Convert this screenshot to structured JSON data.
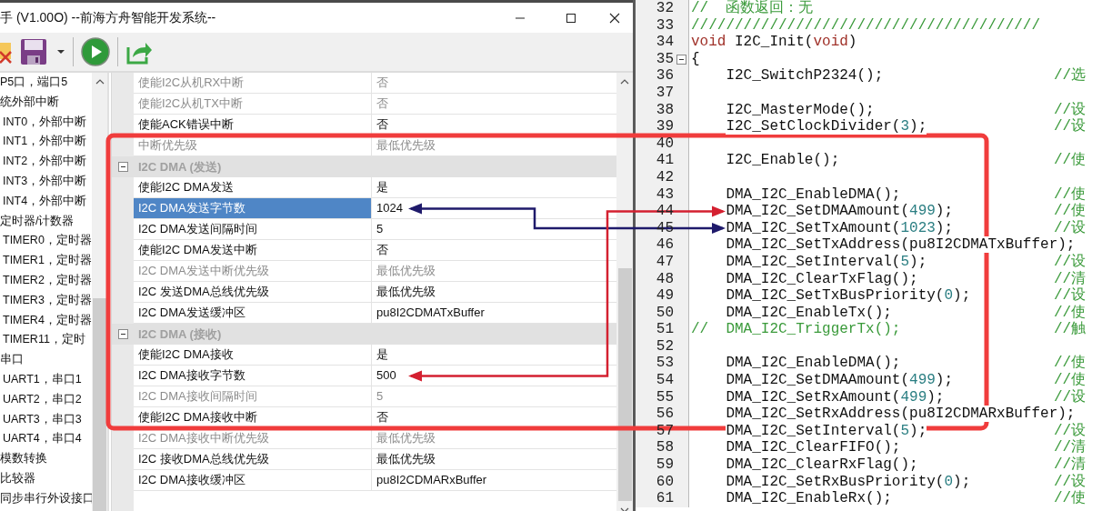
{
  "window": {
    "title": "手 (V1.00O) --前海方舟智能开发系统--"
  },
  "tree": {
    "items": [
      {
        "label": "P5口，端口5"
      },
      {
        "label": "统外部中断",
        "children": [
          {
            "label": "INT0，外部中断"
          },
          {
            "label": "INT1，外部中断"
          },
          {
            "label": "INT2，外部中断"
          },
          {
            "label": "INT3，外部中断"
          },
          {
            "label": "INT4，外部中断"
          }
        ]
      },
      {
        "label": "定时器/计数器",
        "children": [
          {
            "label": "TIMER0，定时器"
          },
          {
            "label": "TIMER1，定时器"
          },
          {
            "label": "TIMER2，定时器"
          },
          {
            "label": "TIMER3，定时器"
          },
          {
            "label": "TIMER4，定时器"
          },
          {
            "label": "TIMER11，定时"
          }
        ]
      },
      {
        "label": "串口",
        "children": [
          {
            "label": "UART1，串口1"
          },
          {
            "label": "UART2，串口2"
          },
          {
            "label": "UART3，串口3"
          },
          {
            "label": "UART4，串口4"
          }
        ]
      },
      {
        "label": "模数转换"
      },
      {
        "label": "比较器"
      },
      {
        "label": "同步串行外设接口"
      }
    ]
  },
  "property_grid": {
    "rows": [
      {
        "kind": "property",
        "name": "使能I2C从机RX中断",
        "value": "否",
        "disabled": true,
        "selected": false
      },
      {
        "kind": "property",
        "name": "使能I2C从机TX中断",
        "value": "否",
        "disabled": true,
        "selected": false
      },
      {
        "kind": "property",
        "name": "使能ACK错误中断",
        "value": "否",
        "disabled": false,
        "selected": false
      },
      {
        "kind": "property",
        "name": "中断优先级",
        "value": "最低优先级",
        "disabled": true,
        "selected": false
      },
      {
        "kind": "category",
        "label": "I2C DMA (发送)",
        "expanded": true
      },
      {
        "kind": "property",
        "name": "使能I2C DMA发送",
        "value": "是",
        "disabled": false,
        "selected": false
      },
      {
        "kind": "property",
        "name": "I2C DMA发送字节数",
        "value": "1024",
        "disabled": false,
        "selected": true
      },
      {
        "kind": "property",
        "name": "I2C DMA发送间隔时间",
        "value": "5",
        "disabled": false,
        "selected": false
      },
      {
        "kind": "property",
        "name": "使能I2C DMA发送中断",
        "value": "否",
        "disabled": false,
        "selected": false
      },
      {
        "kind": "property",
        "name": "I2C DMA发送中断优先级",
        "value": "最低优先级",
        "disabled": true,
        "selected": false
      },
      {
        "kind": "property",
        "name": "I2C 发送DMA总线优先级",
        "value": "最低优先级",
        "disabled": false,
        "selected": false
      },
      {
        "kind": "property",
        "name": "I2C DMA发送缓冲区",
        "value": "pu8I2CDMATxBuffer",
        "disabled": false,
        "selected": false
      },
      {
        "kind": "category",
        "label": "I2C DMA (接收)",
        "expanded": true
      },
      {
        "kind": "property",
        "name": "使能I2C DMA接收",
        "value": "是",
        "disabled": false,
        "selected": false
      },
      {
        "kind": "property",
        "name": "I2C DMA接收字节数",
        "value": "500",
        "disabled": false,
        "selected": false
      },
      {
        "kind": "property",
        "name": "I2C DMA接收间隔时间",
        "value": "5",
        "disabled": true,
        "selected": false
      },
      {
        "kind": "property",
        "name": "使能I2C DMA接收中断",
        "value": "否",
        "disabled": false,
        "selected": false
      },
      {
        "kind": "property",
        "name": "I2C DMA接收中断优先级",
        "value": "最低优先级",
        "disabled": true,
        "selected": false
      },
      {
        "kind": "property",
        "name": "I2C 接收DMA总线优先级",
        "value": "最低优先级",
        "disabled": false,
        "selected": false
      },
      {
        "kind": "property",
        "name": "I2C DMA接收缓冲区",
        "value": "pu8I2CDMARxBuffer",
        "disabled": false,
        "selected": false
      }
    ]
  },
  "editor": {
    "lines": [
      {
        "number": "32",
        "fold": false,
        "parts": [
          {
            "kind": "comment",
            "text": "//  函数返回：无"
          }
        ]
      },
      {
        "number": "33",
        "fold": false,
        "parts": [
          {
            "kind": "comment",
            "text": "////////////////////////////////////////"
          }
        ]
      },
      {
        "number": "34",
        "fold": false,
        "parts": [
          {
            "kind": "keyword",
            "text": "void"
          },
          {
            "kind": "plain",
            "text": " I2C_Init("
          },
          {
            "kind": "keyword",
            "text": "void"
          },
          {
            "kind": "plain",
            "text": ")"
          }
        ]
      },
      {
        "number": "35",
        "fold": true,
        "parts": [
          {
            "kind": "plain",
            "text": "{"
          }
        ]
      },
      {
        "number": "36",
        "fold": false,
        "parts": [
          {
            "kind": "plain",
            "text": "    I2C_SwitchP2324();"
          }
        ],
        "comment": "//选"
      },
      {
        "number": "37",
        "fold": false
      },
      {
        "number": "38",
        "fold": false,
        "parts": [
          {
            "kind": "plain",
            "text": "    I2C_MasterMode();"
          }
        ],
        "comment": "//设"
      },
      {
        "number": "39",
        "fold": false,
        "parts": [
          {
            "kind": "plain",
            "text": "    I2C_SetClockDivider("
          },
          {
            "kind": "number",
            "text": "3"
          },
          {
            "kind": "plain",
            "text": ");"
          }
        ],
        "comment": "//设"
      },
      {
        "number": "40",
        "fold": false
      },
      {
        "number": "41",
        "fold": false,
        "parts": [
          {
            "kind": "plain",
            "text": "    I2C_Enable();"
          }
        ],
        "comment": "//使"
      },
      {
        "number": "42",
        "fold": false
      },
      {
        "number": "43",
        "fold": false,
        "parts": [
          {
            "kind": "plain",
            "text": "    DMA_I2C_EnableDMA();"
          }
        ],
        "comment": "//使"
      },
      {
        "number": "44",
        "fold": false,
        "parts": [
          {
            "kind": "plain",
            "text": "    DMA_I2C_SetDMAAmount("
          },
          {
            "kind": "number",
            "text": "499"
          },
          {
            "kind": "plain",
            "text": ");"
          }
        ],
        "comment": "//使"
      },
      {
        "number": "45",
        "fold": false,
        "parts": [
          {
            "kind": "plain",
            "text": "    DMA_I2C_SetTxAmount("
          },
          {
            "kind": "number",
            "text": "1023"
          },
          {
            "kind": "plain",
            "text": ");"
          }
        ],
        "comment": "//设"
      },
      {
        "number": "46",
        "fold": false,
        "parts": [
          {
            "kind": "plain",
            "text": "    DMA_I2C_SetTxAddress(pu8I2CDMATxBuffer);"
          }
        ]
      },
      {
        "number": "47",
        "fold": false,
        "parts": [
          {
            "kind": "plain",
            "text": "    DMA_I2C_SetInterval("
          },
          {
            "kind": "number",
            "text": "5"
          },
          {
            "kind": "plain",
            "text": ");"
          }
        ],
        "comment": "//设"
      },
      {
        "number": "48",
        "fold": false,
        "parts": [
          {
            "kind": "plain",
            "text": "    DMA_I2C_ClearTxFlag();"
          }
        ],
        "comment": "//清"
      },
      {
        "number": "49",
        "fold": false,
        "parts": [
          {
            "kind": "plain",
            "text": "    DMA_I2C_SetTxBusPriority("
          },
          {
            "kind": "number",
            "text": "0"
          },
          {
            "kind": "plain",
            "text": ");"
          }
        ],
        "comment": "//设"
      },
      {
        "number": "50",
        "fold": false,
        "parts": [
          {
            "kind": "plain",
            "text": "    DMA_I2C_EnableTx();"
          }
        ],
        "comment": "//使"
      },
      {
        "number": "51",
        "fold": false,
        "parts": [
          {
            "kind": "comment",
            "text": "//  DMA_I2C_TriggerTx();"
          }
        ],
        "comment": "//触"
      },
      {
        "number": "52",
        "fold": false
      },
      {
        "number": "53",
        "fold": false,
        "parts": [
          {
            "kind": "plain",
            "text": "    DMA_I2C_EnableDMA();"
          }
        ],
        "comment": "//使"
      },
      {
        "number": "54",
        "fold": false,
        "parts": [
          {
            "kind": "plain",
            "text": "    DMA_I2C_SetDMAAmount("
          },
          {
            "kind": "number",
            "text": "499"
          },
          {
            "kind": "plain",
            "text": ");"
          }
        ],
        "comment": "//使"
      },
      {
        "number": "55",
        "fold": false,
        "parts": [
          {
            "kind": "plain",
            "text": "    DMA_I2C_SetRxAmount("
          },
          {
            "kind": "number",
            "text": "499"
          },
          {
            "kind": "plain",
            "text": ");"
          }
        ],
        "comment": "//设"
      },
      {
        "number": "56",
        "fold": false,
        "parts": [
          {
            "kind": "plain",
            "text": "    DMA_I2C_SetRxAddress(pu8I2CDMARxBuffer);"
          }
        ]
      },
      {
        "number": "57",
        "fold": false,
        "parts": [
          {
            "kind": "plain",
            "text": "    DMA_I2C_SetInterval("
          },
          {
            "kind": "number",
            "text": "5"
          },
          {
            "kind": "plain",
            "text": ");"
          }
        ],
        "comment": "//设"
      },
      {
        "number": "58",
        "fold": false,
        "parts": [
          {
            "kind": "plain",
            "text": "    DMA_I2C_ClearFIFO();"
          }
        ],
        "comment": "//清"
      },
      {
        "number": "59",
        "fold": false,
        "parts": [
          {
            "kind": "plain",
            "text": "    DMA_I2C_ClearRxFlag();"
          }
        ],
        "comment": "//清"
      },
      {
        "number": "60",
        "fold": false,
        "parts": [
          {
            "kind": "plain",
            "text": "    DMA_I2C_SetRxBusPriority("
          },
          {
            "kind": "number",
            "text": "0"
          },
          {
            "kind": "plain",
            "text": ");"
          }
        ],
        "comment": "//设"
      },
      {
        "number": "61",
        "fold": false,
        "parts": [
          {
            "kind": "plain",
            "text": "    DMA_I2C_EnableRx();"
          }
        ],
        "comment": "//使"
      }
    ]
  }
}
